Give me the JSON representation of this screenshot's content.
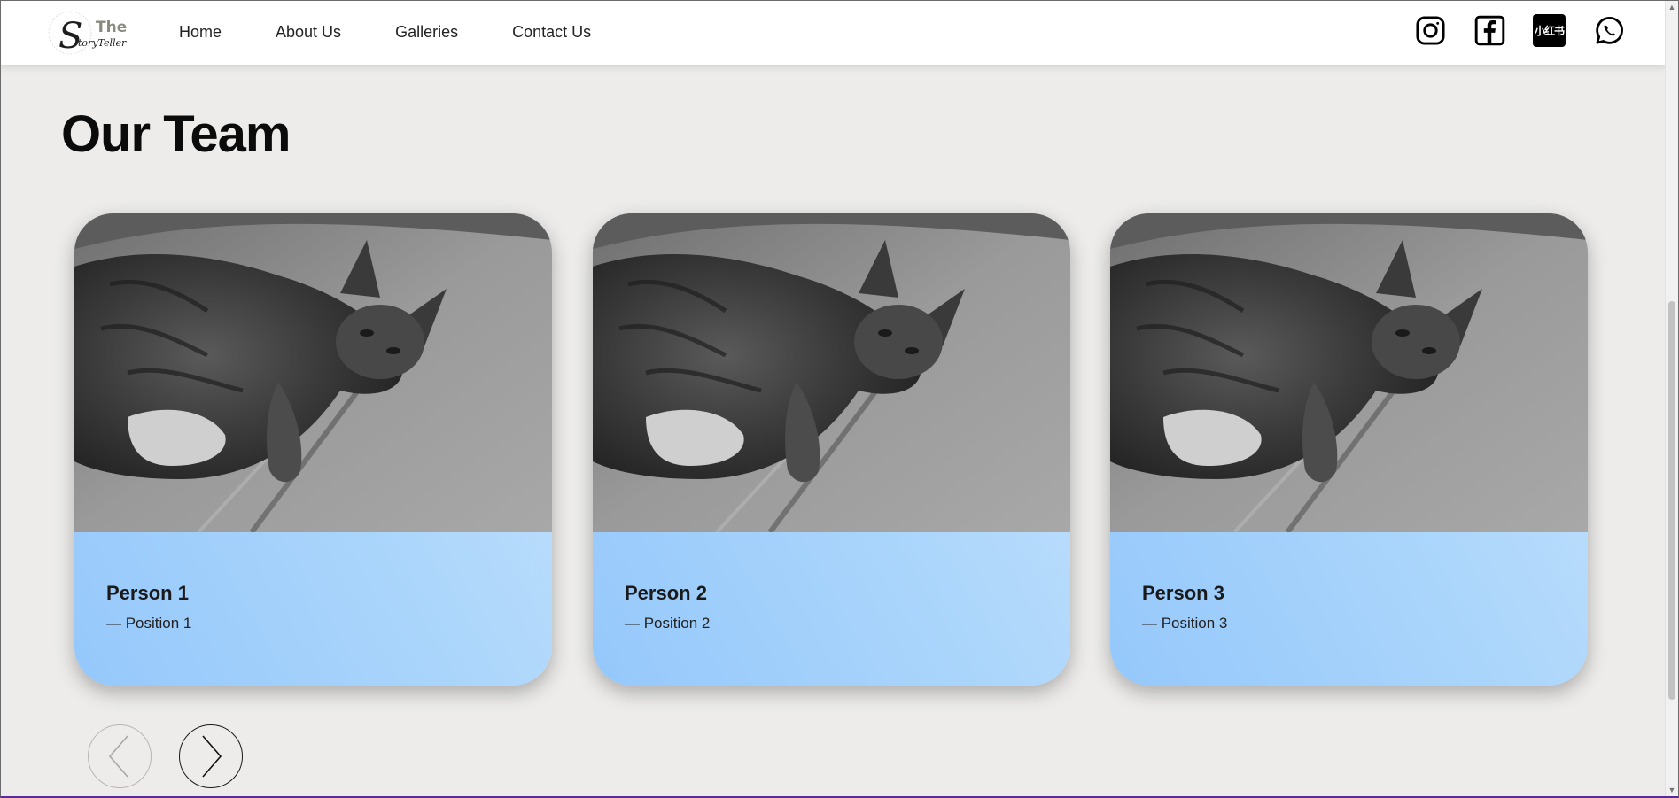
{
  "header": {
    "logo_text": "The StoryTeller",
    "nav": [
      {
        "label": "Home"
      },
      {
        "label": "About Us"
      },
      {
        "label": "Galleries"
      },
      {
        "label": "Contact Us"
      }
    ],
    "socials": [
      {
        "icon": "instagram-icon"
      },
      {
        "icon": "facebook-icon"
      },
      {
        "icon": "xiaohongshu-icon",
        "text": "小红书"
      },
      {
        "icon": "whatsapp-icon"
      }
    ]
  },
  "team": {
    "title": "Our Team",
    "members": [
      {
        "name": "Person 1",
        "position": "— Position 1"
      },
      {
        "name": "Person 2",
        "position": "— Position 2"
      },
      {
        "name": "Person 3",
        "position": "— Position 3"
      }
    ]
  },
  "carousel": {
    "prev_icon": "chevron-left-icon",
    "next_icon": "chevron-right-icon"
  },
  "colors": {
    "page_bg": "#edecea",
    "card_gradient_start": "#95c8fb",
    "card_gradient_end": "#c4e2fc"
  }
}
